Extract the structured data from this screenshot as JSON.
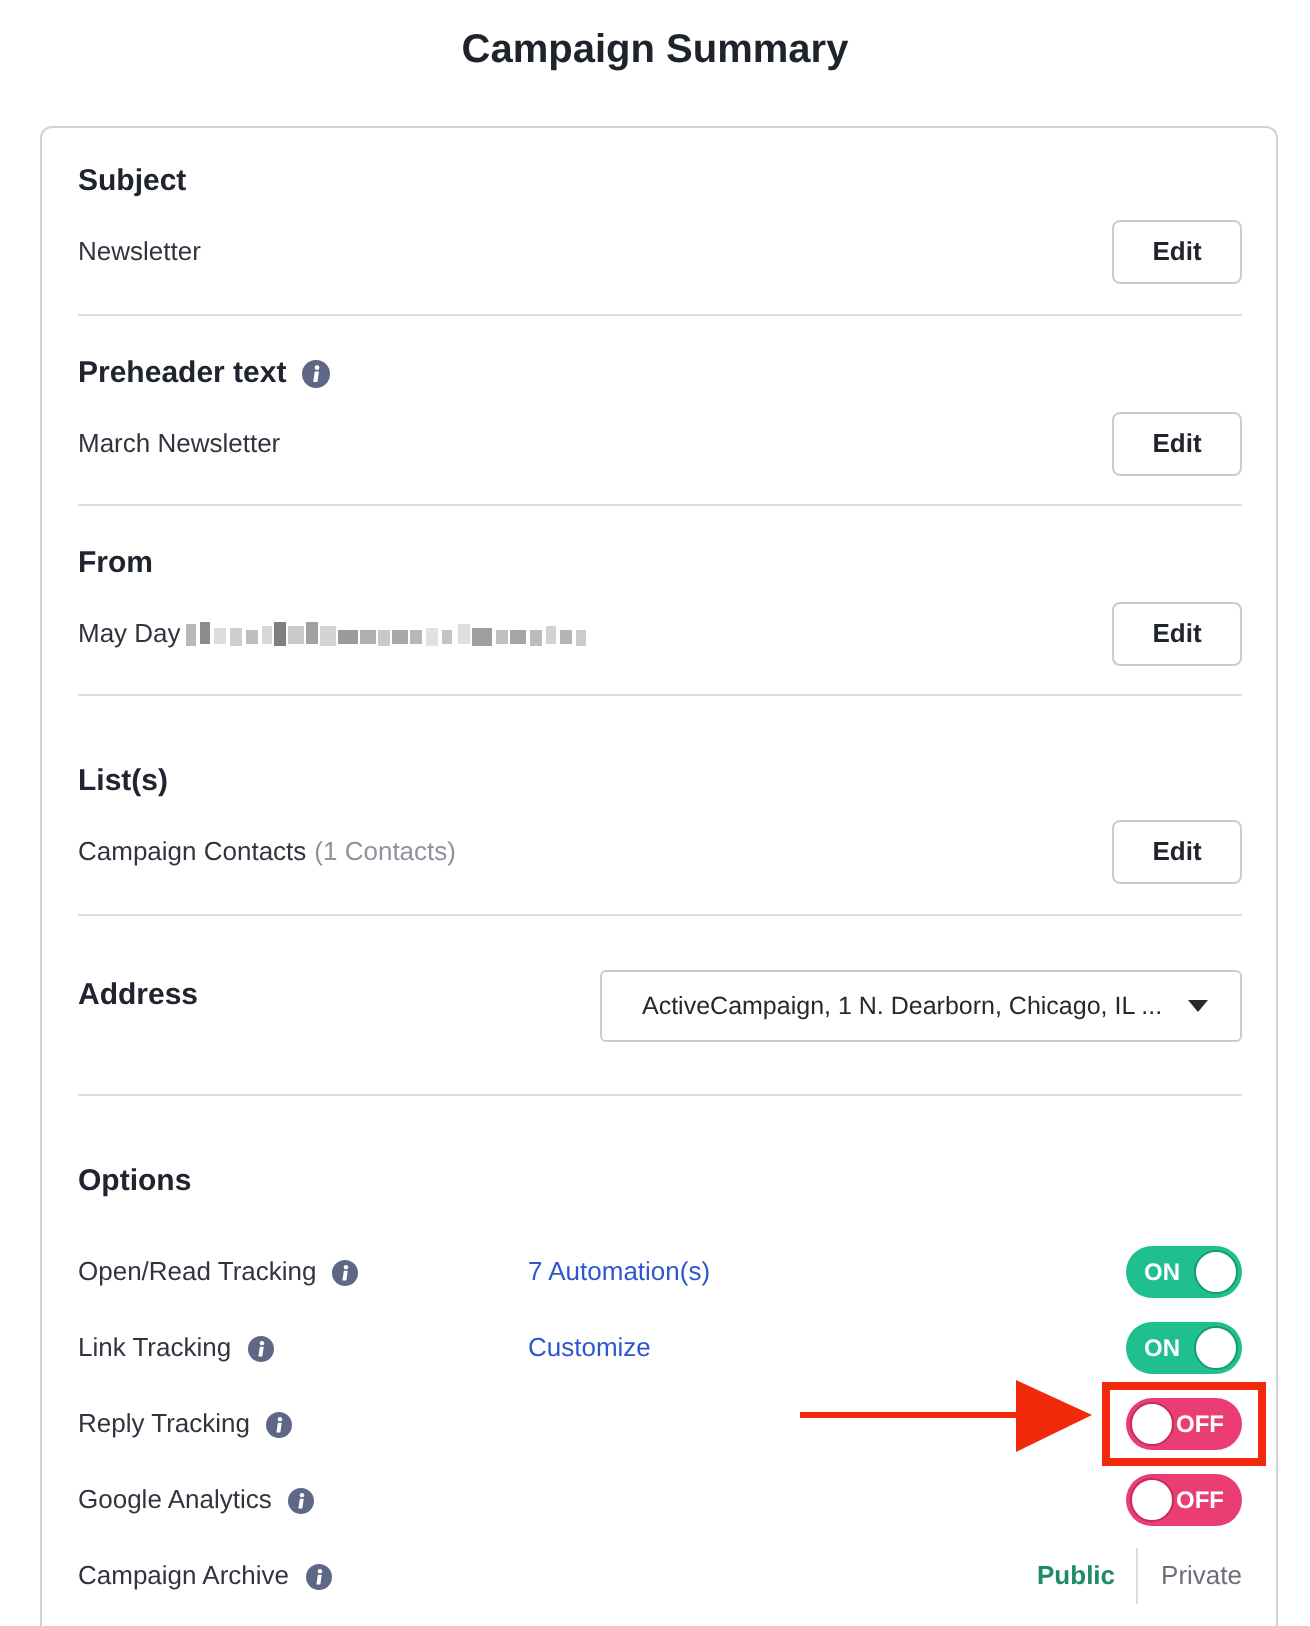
{
  "page": {
    "title": "Campaign Summary"
  },
  "sections": [
    {
      "kind": "edit",
      "heading": "Subject",
      "info": false,
      "value": "Newsletter",
      "button": "Edit"
    },
    {
      "kind": "edit",
      "heading": "Preheader text",
      "info": true,
      "value": "March Newsletter",
      "button": "Edit"
    },
    {
      "kind": "edit",
      "heading": "From",
      "info": false,
      "value": "May Day",
      "redacted": true,
      "button": "Edit"
    },
    {
      "kind": "edit",
      "heading": "List(s)",
      "info": false,
      "value": "Campaign Contacts",
      "count": "(1 Contacts)",
      "button": "Edit"
    },
    {
      "kind": "select",
      "heading": "Address",
      "info": false,
      "value": "ActiveCampaign, 1 N. Dearborn, Chicago, IL ..."
    }
  ],
  "options": {
    "heading": "Options",
    "items": [
      {
        "kind": "toggle",
        "label": "Open/Read Tracking",
        "info": true,
        "link": "7 Automation(s)",
        "on": true,
        "toggle_label": "ON",
        "highlighted": false
      },
      {
        "kind": "toggle",
        "label": "Link Tracking",
        "info": true,
        "link": "Customize",
        "on": true,
        "toggle_label": "ON",
        "highlighted": false
      },
      {
        "kind": "toggle",
        "label": "Reply Tracking",
        "info": true,
        "on": false,
        "toggle_label": "OFF",
        "highlighted": true
      },
      {
        "kind": "toggle",
        "label": "Google Analytics",
        "info": true,
        "on": false,
        "toggle_label": "OFF",
        "highlighted": false
      },
      {
        "kind": "segmented",
        "label": "Campaign Archive",
        "info": true,
        "choices": [
          {
            "label": "Public",
            "selected": true
          },
          {
            "label": "Private",
            "selected": false
          }
        ]
      }
    ]
  }
}
